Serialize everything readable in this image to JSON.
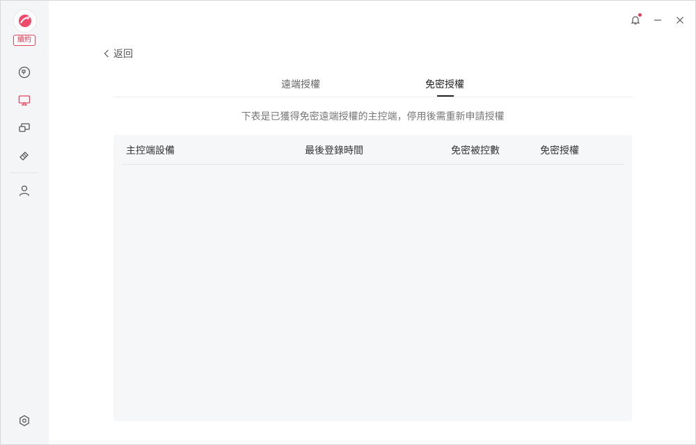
{
  "brand": {
    "badge": "續約"
  },
  "nav": {
    "back_label": "返回"
  },
  "tabs": [
    {
      "label": "遠端授權",
      "active": false
    },
    {
      "label": "免密授權",
      "active": true
    }
  ],
  "notice": "下表是已獲得免密遠端授權的主控端，停用後需重新申請授權",
  "table": {
    "columns": [
      "主控端設備",
      "最後登錄時間",
      "免密被控數",
      "免密授權"
    ],
    "rows": []
  },
  "colors": {
    "accent": "#e0435e",
    "sidebar_bg": "#f4f5f7",
    "table_bg": "#f6f7f9"
  }
}
